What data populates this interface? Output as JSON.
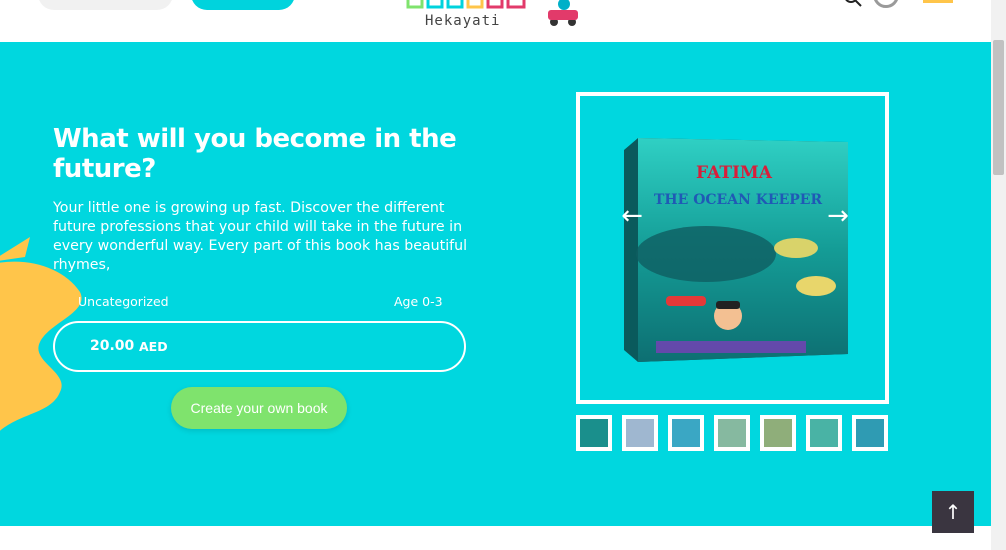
{
  "header": {
    "logo_text": "Hekayati"
  },
  "hero": {
    "title": "What will you become in the future?",
    "description": "Your little one is growing up fast. Discover the different future professions that your child will take in the future in every wonderful way. Every part of this book has beautiful rhymes,",
    "category": "Uncategorized",
    "age": "Age 0-3",
    "price": "20.00",
    "currency": "AED",
    "create_button": "Create your own book"
  },
  "book": {
    "title_line1": "FATIMA",
    "title_line2": "THE OCEAN KEEPER"
  },
  "gallery": {
    "prev_icon": "arrow-left-icon",
    "next_icon": "arrow-right-icon",
    "thumbnail_count": 7
  },
  "scroll_top": {
    "icon": "arrow-up-icon"
  },
  "colors": {
    "hero_bg": "#00d7df",
    "button_green": "#7fe36d",
    "scroll_top_bg": "#3a3540",
    "accent_yellow": "#ffc54a"
  }
}
